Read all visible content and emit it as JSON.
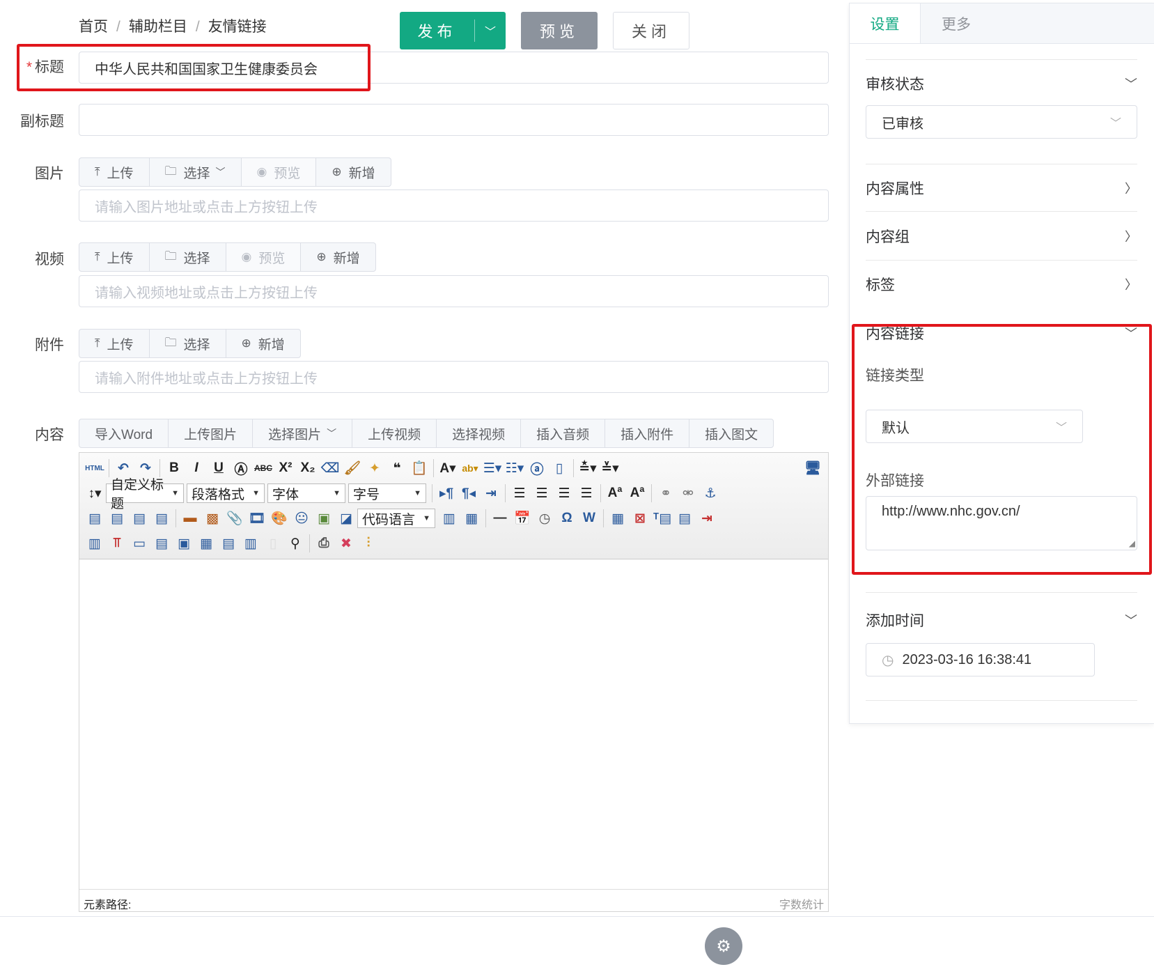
{
  "breadcrumb": {
    "home": "首页",
    "section": "辅助栏目",
    "page": "友情链接",
    "sep": "/"
  },
  "form": {
    "title": {
      "label": "标题",
      "required_mark": "*",
      "value": "中华人民共和国国家卫生健康委员会"
    },
    "subtitle": {
      "label": "副标题",
      "value": ""
    },
    "image": {
      "label": "图片",
      "upload": "上传",
      "select": "选择",
      "preview": "预览",
      "add": "新增",
      "placeholder": "请输入图片地址或点击上方按钮上传"
    },
    "video": {
      "label": "视频",
      "upload": "上传",
      "select": "选择",
      "preview": "预览",
      "add": "新增",
      "placeholder": "请输入视频地址或点击上方按钮上传"
    },
    "attachment": {
      "label": "附件",
      "upload": "上传",
      "select": "选择",
      "add": "新增",
      "placeholder": "请输入附件地址或点击上方按钮上传"
    },
    "content": {
      "label": "内容",
      "toolbar": [
        "导入Word",
        "上传图片",
        "选择图片",
        "上传视频",
        "选择视频",
        "插入音频",
        "插入附件",
        "插入图文"
      ]
    }
  },
  "editor": {
    "selects": {
      "custom_heading": "自定义标题",
      "paragraph": "段落格式",
      "font": "字体",
      "size": "字号",
      "code_lang": "代码语言"
    },
    "status_path": "元素路径:",
    "word_count": "字数统计"
  },
  "footer": {
    "publish": "发布",
    "preview": "预览",
    "close": "关闭"
  },
  "sidebar": {
    "tabs": [
      "设置",
      "更多"
    ],
    "review": {
      "title": "审核状态",
      "value": "已审核"
    },
    "attributes": {
      "title": "内容属性"
    },
    "group": {
      "title": "内容组"
    },
    "tags": {
      "title": "标签"
    },
    "link": {
      "title": "内容链接",
      "type_label": "链接类型",
      "type_value": "默认",
      "external_label": "外部链接",
      "external_value": "http://www.nhc.gov.cn/"
    },
    "time": {
      "title": "添加时间",
      "value": "2023-03-16 16:38:41"
    }
  },
  "colors": {
    "accent": "#13a983",
    "highlight": "#e0161b",
    "muted_button": "#8c939d"
  }
}
